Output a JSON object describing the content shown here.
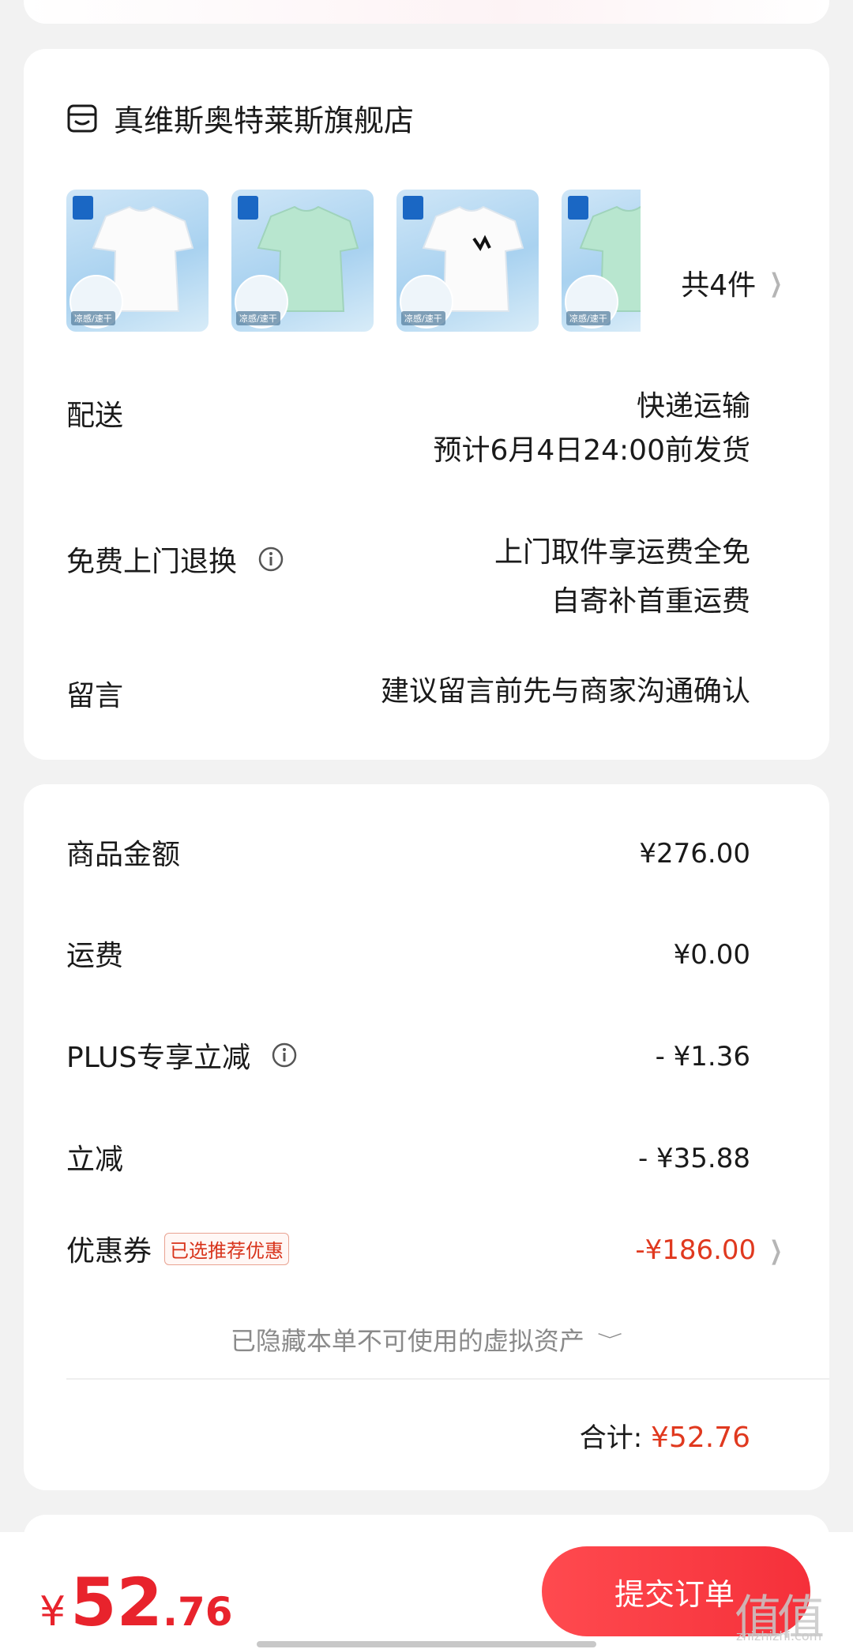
{
  "store": {
    "name": "真维斯奥特莱斯旗舰店",
    "items_count_label": "共4件",
    "products": [
      {
        "color": "white",
        "swatch_text": "凉感/速干"
      },
      {
        "color": "mint",
        "swatch_text": "凉感/速干"
      },
      {
        "color": "white",
        "swatch_text": "凉感/速干"
      },
      {
        "color": "mint",
        "swatch_text": "凉感/速干"
      }
    ]
  },
  "delivery": {
    "label": "配送",
    "method": "快递运输",
    "eta": "预计6月4日24:00前发货"
  },
  "returns": {
    "label": "免费上门退换",
    "line1": "上门取件享运费全免",
    "line2": "自寄补首重运费"
  },
  "message": {
    "label": "留言",
    "placeholder": "建议留言前先与商家沟通确认"
  },
  "price_detail": {
    "goods_label": "商品金额",
    "goods_value": "¥276.00",
    "shipping_label": "运费",
    "shipping_value": "¥0.00",
    "plus_label": "PLUS专享立减",
    "plus_value": "- ¥1.36",
    "discount_label": "立减",
    "discount_value": "- ¥35.88",
    "coupon_label": "优惠券",
    "coupon_tag": "已选推荐优惠",
    "coupon_value": "-¥186.00",
    "hidden_assets": "已隐藏本单不可使用的虚拟资产",
    "total_label": "合计:",
    "total_value": "¥52.76"
  },
  "bottom": {
    "currency": "¥",
    "amount_int": "52",
    "amount_dec": ".76",
    "submit_label": "提交订单"
  },
  "watermark": {
    "logo": "值值值",
    "site": "zhizhizhi.com"
  },
  "colors": {
    "accent": "#e8232c",
    "discount_red": "#e0391f",
    "thumb_blue": "#a9d2f0",
    "mint": "#b8e6cf"
  }
}
